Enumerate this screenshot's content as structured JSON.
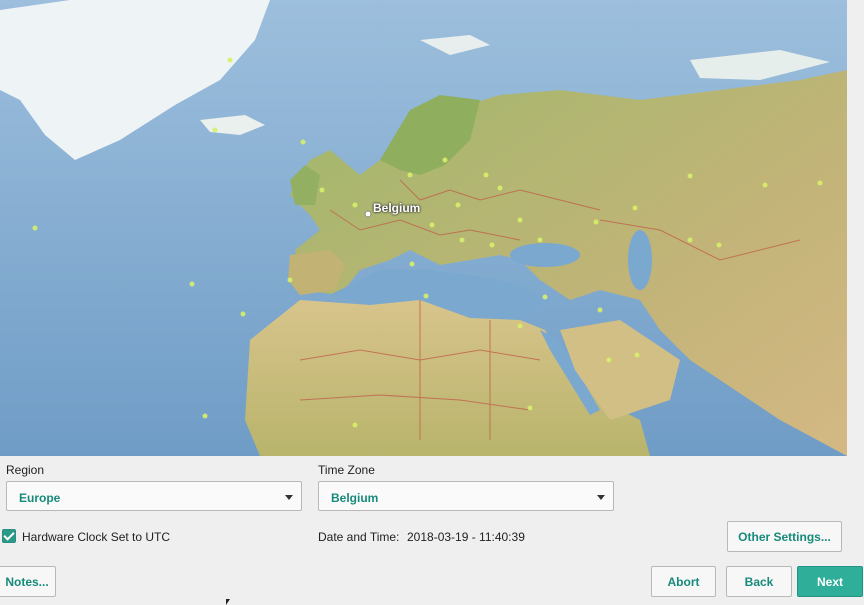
{
  "map": {
    "selected_label": "Belgium",
    "colors": {
      "ocean": "#7fa9cf",
      "land": "#a9b86a",
      "ice": "#eef3f6",
      "border": "#c0604a",
      "city": "#d7f06a"
    }
  },
  "region": {
    "label": "Region",
    "value": "Europe"
  },
  "timezone": {
    "label": "Time Zone",
    "value": "Belgium"
  },
  "hardware_clock": {
    "label": "Hardware Clock Set to UTC",
    "checked": true
  },
  "datetime": {
    "label": "Date and Time:",
    "value": "2018-03-19 - 11:40:39"
  },
  "buttons": {
    "other_settings": "Other Settings...",
    "notes": "Notes...",
    "abort": "Abort",
    "back": "Back",
    "next": "Next"
  },
  "accent": "#2fae9a"
}
